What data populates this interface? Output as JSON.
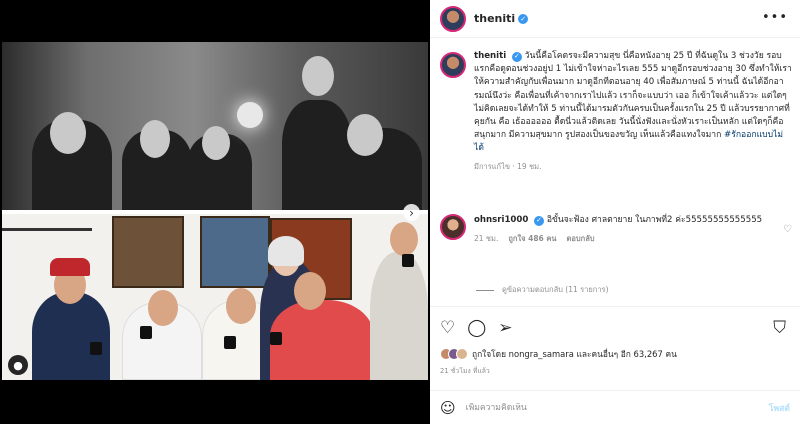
{
  "post": {
    "username": "theniti",
    "more_icon": "more-dots-icon",
    "caption": "วันนี้คือโคตรจะมีความสุข นี่คือหนังอายุ 25 ปี ที่ฉันดูใน 3 ช่วงวัย รอบแรกคือดูตอนช่วงอยู่ป 1 ไม่เข้าใจห่าอะไรเลย 555 มาดูอีกรอบช่วงอายุ 30 ซึ่งทำให้เราให้ความสำคัญกับเพื่อนมาก มาดูอีกทีตอนอายุ 40 เพื่อสัมภาษณ์ 5 ท่านนี้ ฉันได้อีกอารมณ์นึงว่ะ คือเพื่อนที่เค้าจากเราไปแล้ว เราก็จะแบบว่า เออ ก็เข้าใจเค้าแล้ววะ แต่ใดๆ ไม่คิดเลยจะได้ทำให้ 5 ท่านนี้ได้มารมตัวกันครบเป็นครั้งแรกใน 25 ปี แล้วบรรยากาศที่คุยกัน คือ เธ้ออออออ ตื้ดนี่วแล้วติดเลย วันนี้นั่งฟังและนั่งหัวเราะเป็นหลัก แต่ใดๆก็คือ สนุกมาก มีความสุขมาก รูปสองเป็นของขวัญ เห็นแล้วคือแทงใจมาก ",
    "hashtag": "#รักออกแบบไม่ได้",
    "meta": "มีการแก้ไข · 19 ชม."
  },
  "comment": {
    "username": "ohnsri1000",
    "text": "อิขั้นจะฟ้อง ศาลตายาย ในภาพที่2 ค่ะ55555555555555",
    "time": "21 ชม.",
    "likes": "ถูกใจ 486 คน",
    "reply": "ตอบกลับ",
    "view_replies": "ดูข้อความตอบกลับ (11 รายการ)"
  },
  "actions": {
    "liked_by": "ถูกใจโดย nongra_samara และคนอื่นๆ อีก 63,267 คน",
    "time": "21 ชั่วโมง ที่แล้ว"
  },
  "composer": {
    "placeholder": "เพิ่มความคิดเห็น",
    "post_label": "โพสต์"
  },
  "colors": {
    "verified": "#3897f0",
    "ring": "#d62976",
    "link": "#00376b"
  }
}
